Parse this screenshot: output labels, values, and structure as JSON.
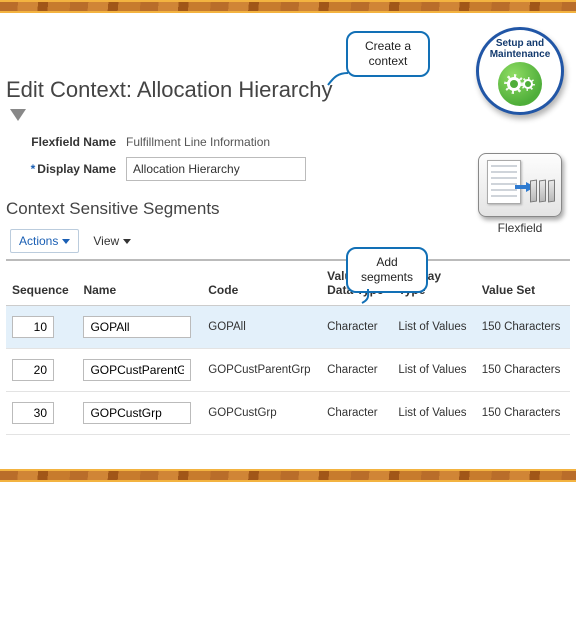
{
  "callouts": {
    "create_context": "Create a\ncontext",
    "add_segments": "Add\nsegments"
  },
  "badges": {
    "setup_label": "Setup and\nMaintenance",
    "flexfield_label": "Flexfield"
  },
  "page": {
    "title": "Edit Context: Allocation Hierarchy"
  },
  "fields": {
    "flexfield_name_label": "Flexfield Name",
    "flexfield_name_value": "Fulfillment Line Information",
    "display_name_label": "Display Name",
    "display_name_value": "Allocation Hierarchy"
  },
  "section": {
    "title": "Context Sensitive Segments"
  },
  "toolbar": {
    "actions_label": "Actions",
    "view_label": "View"
  },
  "table": {
    "headers": {
      "sequence": "Sequence",
      "name": "Name",
      "code": "Code",
      "value_data_type": "Value\nData Type",
      "display_type": "Display\nType",
      "value_set": "Value Set"
    },
    "rows": [
      {
        "sequence": "10",
        "name": "GOPAll",
        "code": "GOPAll",
        "value_data_type": "Character",
        "display_type": "List of Values",
        "value_set": "150 Characters",
        "selected": true
      },
      {
        "sequence": "20",
        "name": "GOPCustParentGrp",
        "code": "GOPCustParentGrp",
        "value_data_type": "Character",
        "display_type": "List of Values",
        "value_set": "150 Characters",
        "selected": false
      },
      {
        "sequence": "30",
        "name": "GOPCustGrp",
        "code": "GOPCustGrp",
        "value_data_type": "Character",
        "display_type": "List of Values",
        "value_set": "150 Characters",
        "selected": false
      }
    ]
  }
}
